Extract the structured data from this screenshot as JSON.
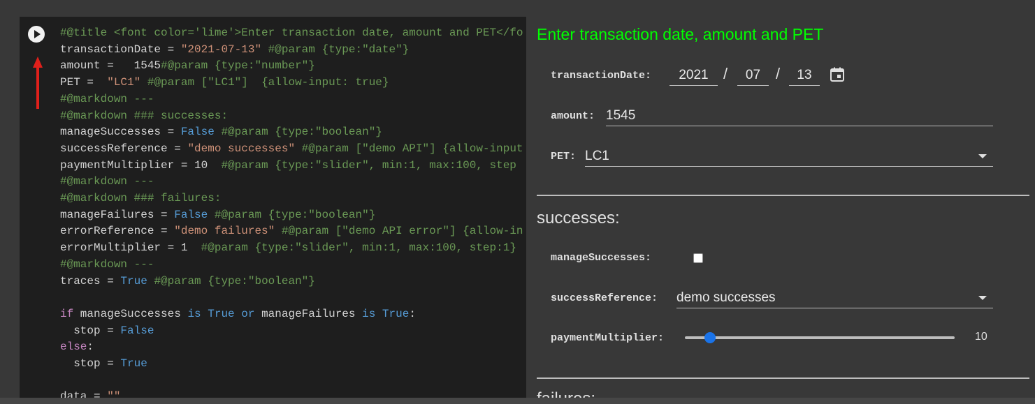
{
  "code": [
    [
      [
        "cm",
        "#@title <font color='lime'>Enter transaction date, amount and PET</fo"
      ]
    ],
    [
      [
        "",
        "transactionDate = "
      ],
      [
        "st",
        "\"2021-07-13\""
      ],
      [
        "",
        " "
      ],
      [
        "cm",
        "#@param {type:\"date\"}"
      ]
    ],
    [
      [
        "",
        "amount =   1545"
      ],
      [
        "cm",
        "#@param {type:\"number\"}"
      ]
    ],
    [
      [
        "",
        "PET =  "
      ],
      [
        "st",
        "\"LC1\""
      ],
      [
        "",
        " "
      ],
      [
        "cm",
        "#@param [\"LC1\"]  {allow-input: true}"
      ]
    ],
    [
      [
        "cm",
        "#@markdown ---"
      ]
    ],
    [
      [
        "cm",
        "#@markdown ### successes:"
      ]
    ],
    [
      [
        "",
        "manageSuccesses = "
      ],
      [
        "kw",
        "False"
      ],
      [
        "",
        " "
      ],
      [
        "cm",
        "#@param {type:\"boolean\"}"
      ]
    ],
    [
      [
        "",
        "successReference = "
      ],
      [
        "st",
        "\"demo successes\""
      ],
      [
        "",
        " "
      ],
      [
        "cm",
        "#@param [\"demo API\"] {allow-input"
      ]
    ],
    [
      [
        "",
        "paymentMultiplier = 10  "
      ],
      [
        "cm",
        "#@param {type:\"slider\", min:1, max:100, step"
      ]
    ],
    [
      [
        "cm",
        "#@markdown ---"
      ]
    ],
    [
      [
        "cm",
        "#@markdown ### failures:"
      ]
    ],
    [
      [
        "",
        "manageFailures = "
      ],
      [
        "kw",
        "False"
      ],
      [
        "",
        " "
      ],
      [
        "cm",
        "#@param {type:\"boolean\"}"
      ]
    ],
    [
      [
        "",
        "errorReference = "
      ],
      [
        "st",
        "\"demo failures\""
      ],
      [
        "",
        " "
      ],
      [
        "cm",
        "#@param [\"demo API error\"] {allow-in"
      ]
    ],
    [
      [
        "",
        "errorMultiplier = 1  "
      ],
      [
        "cm",
        "#@param {type:\"slider\", min:1, max:100, step:1}"
      ]
    ],
    [
      [
        "cm",
        "#@markdown ---"
      ]
    ],
    [
      [
        "",
        "traces = "
      ],
      [
        "kw",
        "True"
      ],
      [
        "",
        " "
      ],
      [
        "cm",
        "#@param {type:\"boolean\"}"
      ]
    ],
    [],
    [
      [
        "ctl",
        "if"
      ],
      [
        "",
        " manageSuccesses "
      ],
      [
        "kw",
        "is"
      ],
      [
        "",
        " "
      ],
      [
        "kw",
        "True"
      ],
      [
        "",
        " "
      ],
      [
        "kw",
        "or"
      ],
      [
        "",
        " manageFailures "
      ],
      [
        "kw",
        "is"
      ],
      [
        "",
        " "
      ],
      [
        "kw",
        "True"
      ],
      [
        "",
        ":"
      ]
    ],
    [
      [
        "",
        "  stop = "
      ],
      [
        "kw",
        "False"
      ]
    ],
    [
      [
        "ctl",
        "else"
      ],
      [
        "",
        ":"
      ]
    ],
    [
      [
        "",
        "  stop = "
      ],
      [
        "kw",
        "True"
      ]
    ],
    [],
    [
      [
        "",
        "data = "
      ],
      [
        "st",
        "\"\""
      ]
    ]
  ],
  "form": {
    "title": "Enter transaction date, amount and PET",
    "transaction_date": {
      "label": "transactionDate:",
      "year": "2021",
      "month": "07",
      "day": "13",
      "separator": "/"
    },
    "amount": {
      "label": "amount:",
      "value": "1545"
    },
    "pet": {
      "label": "PET:",
      "value": "LC1"
    },
    "successes_heading": "successes:",
    "manage_successes": {
      "label": "manageSuccesses:",
      "checked": false
    },
    "success_reference": {
      "label": "successReference:",
      "value": "demo successes"
    },
    "payment_multiplier": {
      "label": "paymentMultiplier:",
      "value": "10",
      "min": 1,
      "max": 100,
      "current": 10
    },
    "failures_heading": "failures:"
  },
  "colors": {
    "title": "#00ff00",
    "slider": "#1a73e8",
    "arrow": "#e0201b"
  }
}
